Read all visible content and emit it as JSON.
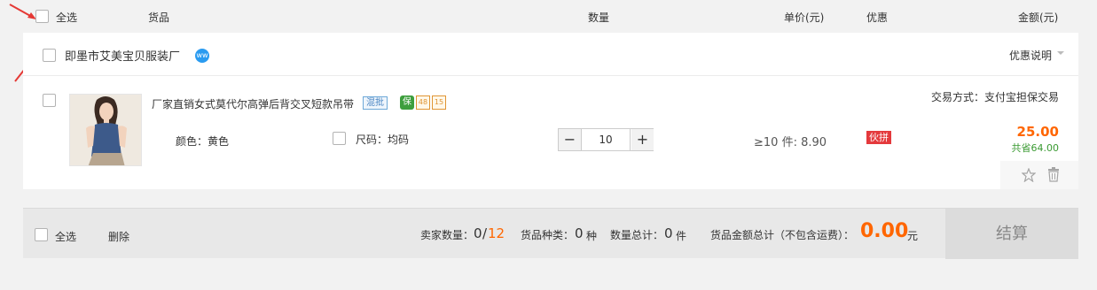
{
  "header": {
    "select_all": "全选",
    "col_goods": "货品",
    "col_quantity": "数量",
    "col_unit_price": "单价(元)",
    "col_discount": "优惠",
    "col_amount": "金额(元)"
  },
  "shop": {
    "name": "即墨市艾美宝贝服装厂",
    "wangwang_glyph": "ww",
    "promo_label": "优惠说明"
  },
  "item": {
    "title": "厂家直销女式莫代尔高弹后背交叉短款吊带",
    "tag_mixed": "混批",
    "tag_protect": "保",
    "tag_48": "48",
    "tag_15": "15",
    "color_label": "颜色：黄色",
    "size_label": "尺码：均码",
    "minus": "−",
    "plus": "+",
    "quantity": "10",
    "unit_price": "≥10 件:  8.90",
    "group_badge": "伙拼",
    "trade_method": "交易方式：支付宝担保交易",
    "amount": "25.00",
    "saved": "共省64.00",
    "star_glyph": "☆",
    "trash_glyph": "🗑"
  },
  "footer": {
    "select_all": "全选",
    "delete": "删除",
    "seller_count_label": "卖家数量：",
    "seller_count_value": "0",
    "seller_count_sep": "/",
    "seller_count_total": "12",
    "kinds_label": "货品种类：",
    "kinds_value": "0",
    "kinds_unit": "种",
    "qty_total_label": "数量总计：",
    "qty_total_value": "0",
    "qty_total_unit": "件",
    "total_label": "货品金额总计（不包含运费）：",
    "total_value": "0.00",
    "total_unit": "元",
    "checkout": "结算"
  },
  "colors": {
    "accent_orange": "#ff6600",
    "annotation_red": "#e53935",
    "saved_green": "#3a9a32"
  }
}
